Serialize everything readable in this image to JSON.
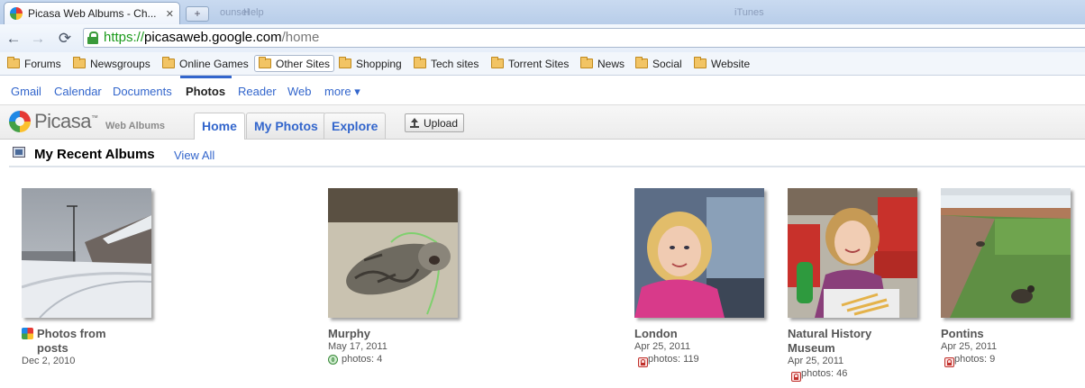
{
  "browser": {
    "tab_title": "Picasa Web Albums - Ch...",
    "tab_close": "✕",
    "new_tab": "+",
    "ghost_menu": [
      "ounsel",
      "Help",
      "iTunes"
    ]
  },
  "toolbar": {
    "back": "←",
    "forward": "→",
    "reload": "⟳",
    "url_scheme": "https://",
    "url_host": "picasaweb.google.com",
    "url_path": "/home"
  },
  "bookmarks": [
    {
      "label": "Forums"
    },
    {
      "label": "Newsgroups"
    },
    {
      "label": "Online Games"
    },
    {
      "label": "Other Sites"
    },
    {
      "label": "Shopping"
    },
    {
      "label": "Tech sites"
    },
    {
      "label": "Torrent Sites"
    },
    {
      "label": "News"
    },
    {
      "label": "Social"
    },
    {
      "label": "Website"
    }
  ],
  "google_bar": {
    "links": [
      "Gmail",
      "Calendar",
      "Documents",
      "Photos",
      "Reader",
      "Web",
      "more ▾"
    ],
    "current": "Photos"
  },
  "picasa": {
    "logo": "Picasa",
    "logo_tm": "™",
    "logo_sub": "Web Albums",
    "tabs": [
      "Home",
      "My Photos",
      "Explore"
    ],
    "active_tab": "Home",
    "upload_label": "Upload"
  },
  "section": {
    "title": "My Recent Albums",
    "view_all": "View All"
  },
  "albums": [
    {
      "title": "Photos from posts",
      "date": "Dec 2, 2010",
      "count": "",
      "visibility": "posts"
    },
    {
      "title": "Murphy",
      "date": "May 17, 2011",
      "count": "photos: 4",
      "visibility": "public"
    },
    {
      "title": "London",
      "date": "Apr 25, 2011",
      "count": "photos: 119",
      "visibility": "private"
    },
    {
      "title": "Natural History Museum",
      "date": "Apr 25, 2011",
      "count": "photos: 46",
      "visibility": "private"
    },
    {
      "title": "Pontins",
      "date": "Apr 25, 2011",
      "count": "photos: 9",
      "visibility": "private"
    }
  ],
  "colors": {
    "link": "#3366cc",
    "secure_green": "#1a9a1a",
    "lock_red": "#c0302b"
  }
}
